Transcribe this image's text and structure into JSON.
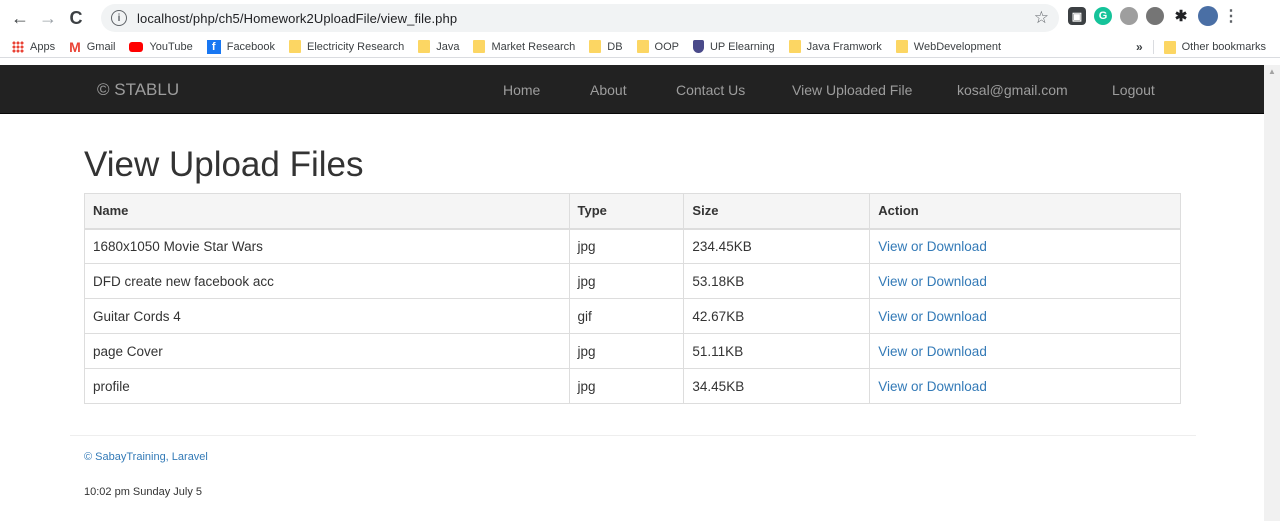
{
  "browser": {
    "url": "localhost/php/ch5/Homework2UploadFile/view_file.php",
    "bookmarks": [
      {
        "label": "Apps",
        "icon": "apps-grid-icon"
      },
      {
        "label": "Gmail",
        "icon": "gmail-icon"
      },
      {
        "label": "YouTube",
        "icon": "youtube-icon"
      },
      {
        "label": "Facebook",
        "icon": "facebook-icon"
      },
      {
        "label": "Electricity Research",
        "icon": "folder-icon"
      },
      {
        "label": "Java",
        "icon": "folder-icon"
      },
      {
        "label": "Market Research",
        "icon": "folder-icon"
      },
      {
        "label": "DB",
        "icon": "folder-icon"
      },
      {
        "label": "OOP",
        "icon": "folder-icon"
      },
      {
        "label": "UP Elearning",
        "icon": "shield-icon"
      },
      {
        "label": "Java Framwork",
        "icon": "folder-icon"
      },
      {
        "label": "WebDevelopment",
        "icon": "folder-icon"
      }
    ],
    "more": "»",
    "other_bookmarks": "Other bookmarks"
  },
  "navbar": {
    "brand": "© STABLU",
    "links": [
      "Home",
      "About",
      "Contact Us",
      "View Uploaded File",
      "kosal@gmail.com",
      "Logout"
    ]
  },
  "page": {
    "title": "View Upload Files",
    "table": {
      "headers": [
        "Name",
        "Type",
        "Size",
        "Action"
      ],
      "rows": [
        {
          "name": "1680x1050 Movie Star Wars",
          "type": "jpg",
          "size": "234.45KB",
          "action": "View or Download"
        },
        {
          "name": "DFD create new facebook acc",
          "type": "jpg",
          "size": "53.18KB",
          "action": "View or Download"
        },
        {
          "name": "Guitar Cords 4",
          "type": "gif",
          "size": "42.67KB",
          "action": "View or Download"
        },
        {
          "name": "page Cover",
          "type": "jpg",
          "size": "51.11KB",
          "action": "View or Download"
        },
        {
          "name": "profile",
          "type": "jpg",
          "size": "34.45KB",
          "action": "View or Download"
        }
      ]
    }
  },
  "footer": {
    "credit": "© SabayTraining, Laravel",
    "time": "10:02 pm Sunday July 5"
  },
  "colors": {
    "navbar_bg": "#222222",
    "link": "#337ab7",
    "nav_text": "#9d9d9d"
  }
}
